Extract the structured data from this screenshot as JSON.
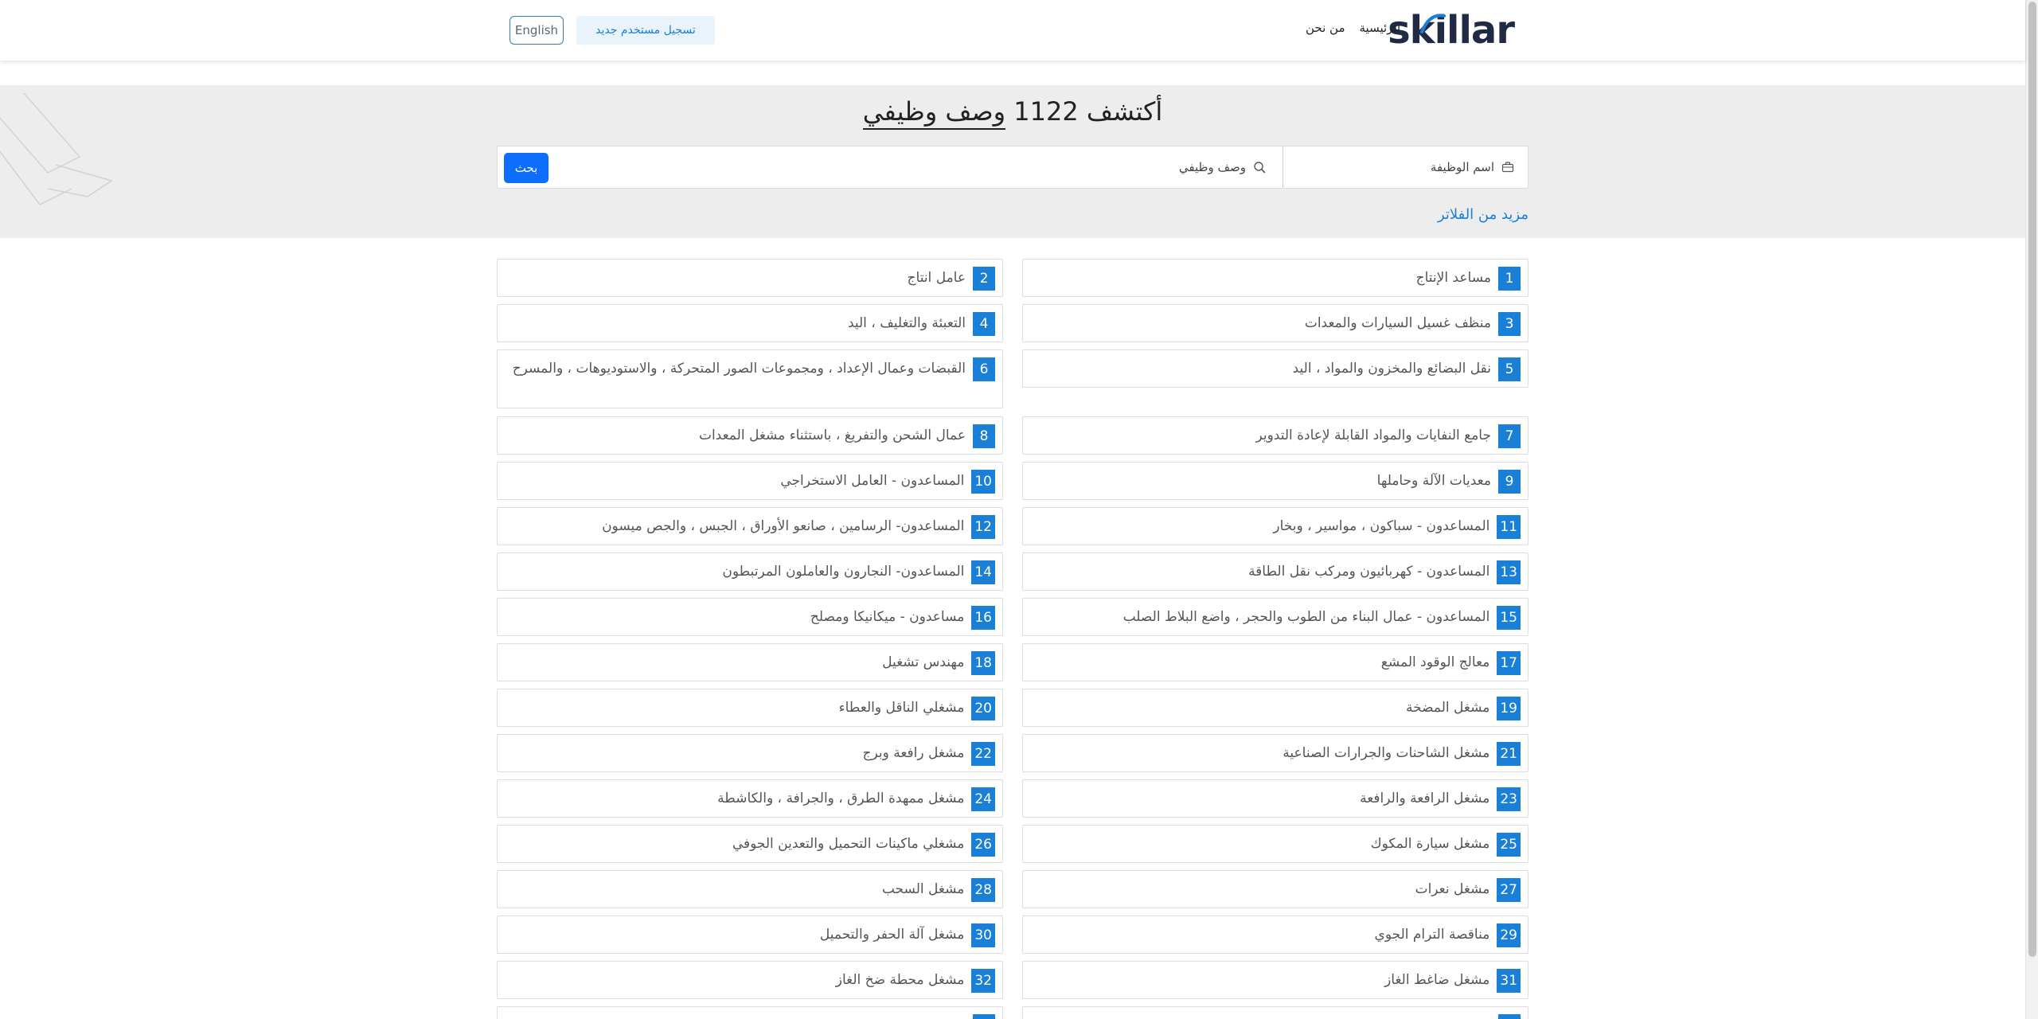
{
  "header": {
    "logo_text": "skillar",
    "nav": [
      {
        "label": "الرئيسية"
      },
      {
        "label": "من نحن"
      }
    ],
    "register_label": "تسجيل مستخدم جديد",
    "language_label": "English"
  },
  "hero": {
    "title_prefix": "أكتشف 1122",
    "title_underlined": "وصف وظيفي",
    "job_title_placeholder": "اسم الوظيفة",
    "job_desc_placeholder": "وصف وظيفي",
    "search_label": "بحث",
    "more_filters_label": "مزيد من الفلاتر"
  },
  "colors": {
    "accent": "#1a7fd6",
    "search_button": "#0d6efd",
    "hero_bg": "#ededed"
  },
  "jobs": [
    {
      "num": "1",
      "title": "مساعد الإنتاج"
    },
    {
      "num": "2",
      "title": "عامل انتاج"
    },
    {
      "num": "3",
      "title": "منظف غسيل السيارات والمعدات"
    },
    {
      "num": "4",
      "title": "التعبئة والتغليف ، اليد"
    },
    {
      "num": "5",
      "title": "نقل البضائع والمخزون والمواد ، اليد"
    },
    {
      "num": "6",
      "title": "القبضات وعمال الإعداد ، ومجموعات الصور المتحركة ، والاستوديوهات ، والمسرح"
    },
    {
      "num": "7",
      "title": "جامع النفايات والمواد القابلة لإعادة التدوير"
    },
    {
      "num": "8",
      "title": "عمال الشحن والتفريغ ، باستثناء مشغل المعدات"
    },
    {
      "num": "9",
      "title": "معديات الآلة وحاملها"
    },
    {
      "num": "10",
      "title": "المساعدون - العامل الاستخراجي"
    },
    {
      "num": "11",
      "title": "المساعدون - سباكون ، مواسير ، وبخار"
    },
    {
      "num": "12",
      "title": "المساعدون- الرسامين ، صانعو الأوراق ، الجبس ، والجص ميسون"
    },
    {
      "num": "13",
      "title": "المساعدون - كهربائيون ومركب نقل الطاقة"
    },
    {
      "num": "14",
      "title": "المساعدون- النجارون والعاملون المرتبطون"
    },
    {
      "num": "15",
      "title": "المساعدون - عمال البناء من الطوب والحجر ، واضع البلاط الصلب"
    },
    {
      "num": "16",
      "title": "مساعدون - ميكانيكا ومصلح"
    },
    {
      "num": "17",
      "title": "معالج الوقود المشع"
    },
    {
      "num": "18",
      "title": "مهندس تشغيل"
    },
    {
      "num": "19",
      "title": "مشغل المضخة"
    },
    {
      "num": "20",
      "title": "مشغلي الناقل والعطاء"
    },
    {
      "num": "21",
      "title": "مشغل الشاحنات والجرارات الصناعية"
    },
    {
      "num": "22",
      "title": "مشغل رافعة وبرج"
    },
    {
      "num": "23",
      "title": "مشغل الرافعة والرافعة"
    },
    {
      "num": "24",
      "title": "مشغل ممهدة الطرق ، والجرافة ، والكاشطة"
    },
    {
      "num": "25",
      "title": "مشغل سيارة المكوك"
    },
    {
      "num": "26",
      "title": "مشغلي ماكينات التحميل والتعدين الجوفي"
    },
    {
      "num": "27",
      "title": "مشغل نعرات"
    },
    {
      "num": "28",
      "title": "مشغل السحب"
    },
    {
      "num": "29",
      "title": "مناقصة الترام الجوي"
    },
    {
      "num": "30",
      "title": "مشغل آلة الحفر والتحميل"
    },
    {
      "num": "31",
      "title": "مشغل ضاغط الغاز"
    },
    {
      "num": "32",
      "title": "مشغل محطة ضخ الغاز"
    }
  ]
}
